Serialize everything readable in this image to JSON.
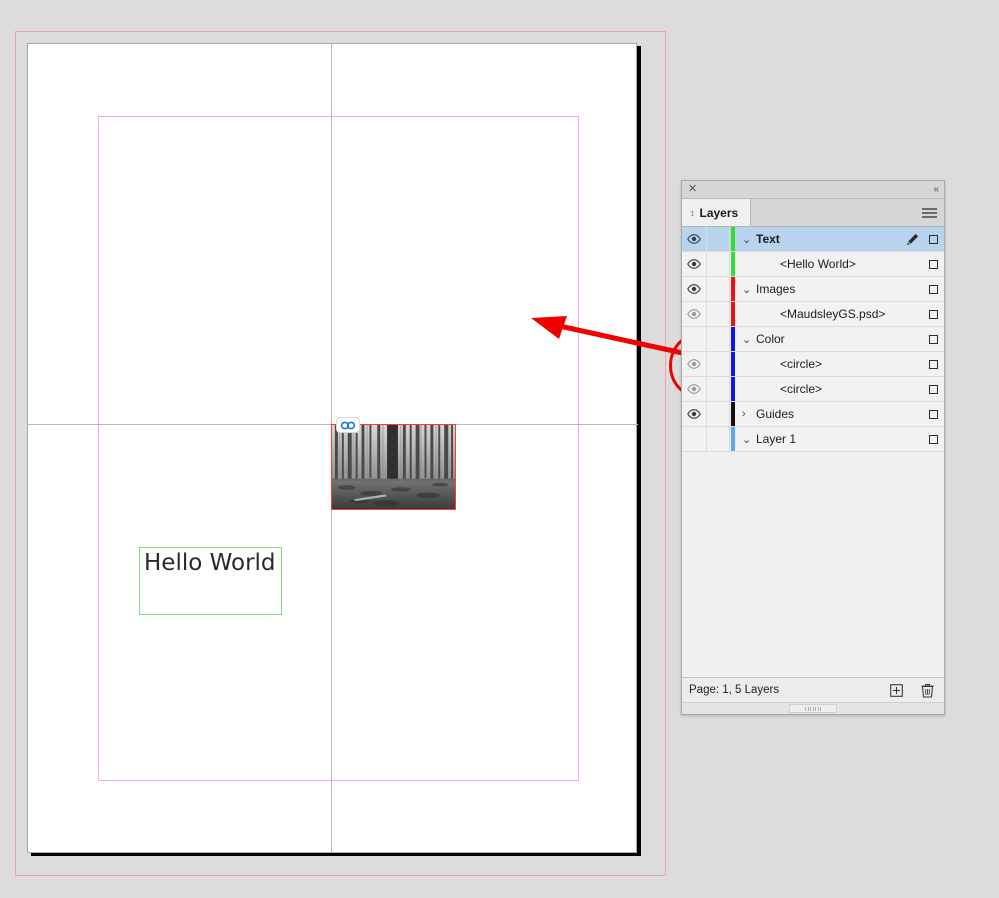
{
  "canvas": {
    "background_color": "#dcdcdc",
    "page_color": "#ffffff",
    "bleed_color": "#f4a0b0",
    "margin_guide_color": "#f4a8f4",
    "ruler_guide_color": "#b9b9b9",
    "text_frame": {
      "content": "Hello World",
      "frame_color": "#7ddc8a"
    },
    "image_frame": {
      "alt": "grayscale forest photograph",
      "frame_color": "#ff3b30",
      "badge_icon": "link-icon"
    }
  },
  "annotations": {
    "arrow_color": "#f20000",
    "ellipse_color": "#f20000"
  },
  "panel": {
    "title": "Layers",
    "close_label": "✕",
    "collapse_label": "«",
    "menu_icon": "hamburger-icon",
    "tab_grip_icon": "grip-icon",
    "columns": {
      "eye": "visibility-icon",
      "lock": "lock-column",
      "target": "target-square-icon",
      "pen": "pen-icon"
    },
    "rows": [
      {
        "name": "Text",
        "indent": false,
        "bold": true,
        "chevron": "⌄",
        "color": "#33dd33",
        "visible": true,
        "eye_dim": false,
        "selected": true,
        "pen": true
      },
      {
        "name": "<Hello World>",
        "indent": true,
        "bold": false,
        "chevron": "",
        "color": "#33dd33",
        "visible": true,
        "eye_dim": false,
        "selected": false,
        "pen": false
      },
      {
        "name": "Images",
        "indent": false,
        "bold": false,
        "chevron": "⌄",
        "color": "#ee1111",
        "visible": true,
        "eye_dim": false,
        "selected": false,
        "pen": false
      },
      {
        "name": "<MaudsleyGS.psd>",
        "indent": true,
        "bold": false,
        "chevron": "",
        "color": "#ee1111",
        "visible": true,
        "eye_dim": true,
        "selected": false,
        "pen": false
      },
      {
        "name": "Color",
        "indent": false,
        "bold": false,
        "chevron": "⌄",
        "color": "#1111ee",
        "visible": false,
        "eye_dim": false,
        "selected": false,
        "pen": false
      },
      {
        "name": "<circle>",
        "indent": true,
        "bold": false,
        "chevron": "",
        "color": "#1111ee",
        "visible": true,
        "eye_dim": true,
        "selected": false,
        "pen": false
      },
      {
        "name": "<circle>",
        "indent": true,
        "bold": false,
        "chevron": "",
        "color": "#1111ee",
        "visible": true,
        "eye_dim": true,
        "selected": false,
        "pen": false
      },
      {
        "name": "Guides",
        "indent": false,
        "bold": false,
        "chevron": "›",
        "color": "#111111",
        "visible": true,
        "eye_dim": false,
        "selected": false,
        "pen": false
      },
      {
        "name": "Layer 1",
        "indent": false,
        "bold": false,
        "chevron": "⌄",
        "color": "#5aaaee",
        "visible": false,
        "eye_dim": false,
        "selected": false,
        "pen": false
      }
    ],
    "footer": {
      "status": "Page: 1, 5 Layers",
      "new_layer_icon": "plus-square-icon",
      "delete_icon": "trash-icon"
    }
  }
}
